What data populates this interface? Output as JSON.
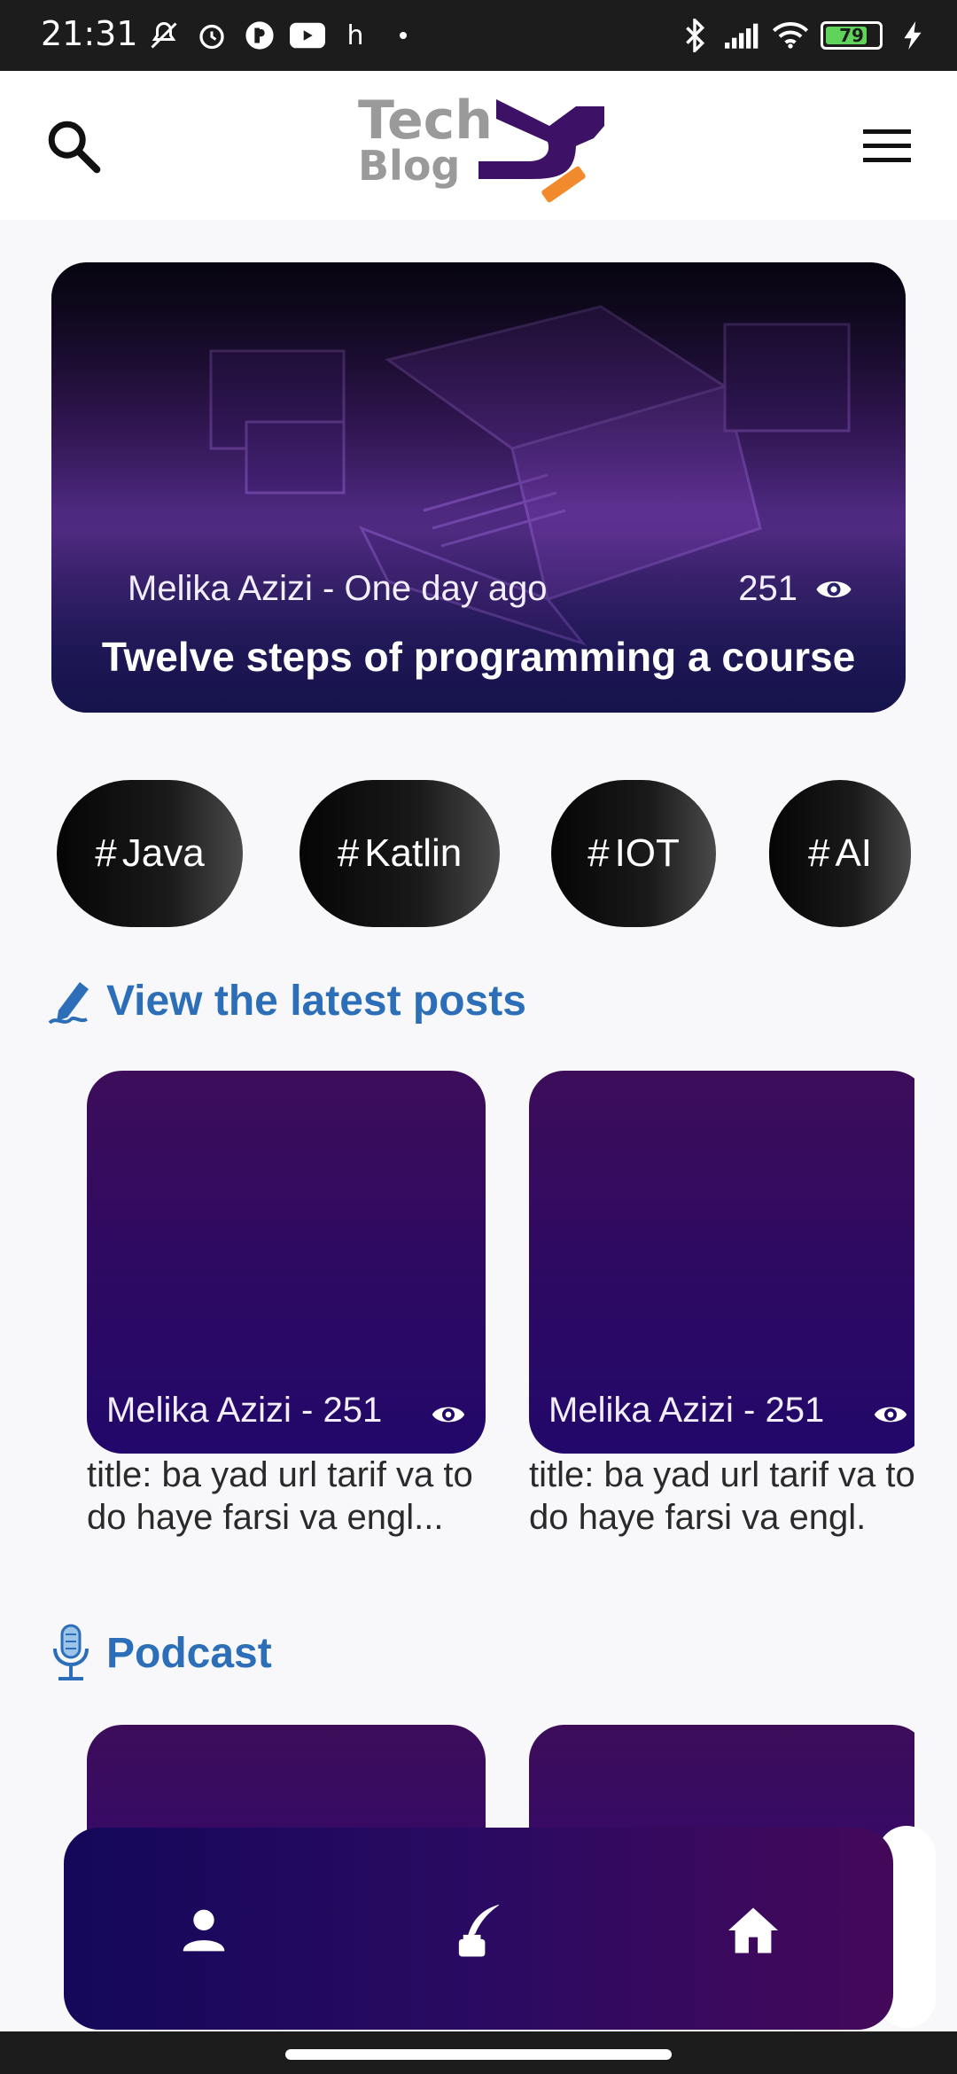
{
  "status_bar": {
    "time": "21:31",
    "notification_letter": "h",
    "battery_level": "79",
    "battery_fraction": 0.79,
    "left_icons": [
      "mute-icon",
      "alarm-icon",
      "app-p-icon",
      "youtube-icon"
    ],
    "right_icons": [
      "bluetooth-icon",
      "signal-icon",
      "wifi-icon",
      "battery-icon",
      "charging-icon"
    ]
  },
  "header": {
    "logo_line1": "Tech",
    "logo_line2": "Blog",
    "brand_colors": {
      "purple": "#3d1266",
      "orange": "#f08a2c",
      "gray": "#9a9a9a"
    },
    "search_icon": "search-icon",
    "menu_icon": "menu-icon"
  },
  "hero": {
    "author_time": "Melika Azizi - One day ago",
    "views": "251",
    "title": "Twelve steps of programming a course"
  },
  "tags": [
    {
      "label": "Java"
    },
    {
      "label": "Katlin"
    },
    {
      "label": "IOT"
    },
    {
      "label": "AI"
    }
  ],
  "latest_posts": {
    "heading": "View the latest posts",
    "icon": "pen-icon",
    "items": [
      {
        "meta": "Melika Azizi - 251",
        "title": "title: ba yad url tarif va to do haye farsi va engl..."
      },
      {
        "meta": "Melika Azizi - 251",
        "title": "title: ba yad url tarif va to do haye farsi va engl."
      }
    ]
  },
  "podcast": {
    "heading": "Podcast",
    "icon": "microphone-icon"
  },
  "bottom_nav": {
    "items": [
      "profile-icon",
      "write-post-icon",
      "home-icon"
    ],
    "accent": "#2a0a62"
  }
}
